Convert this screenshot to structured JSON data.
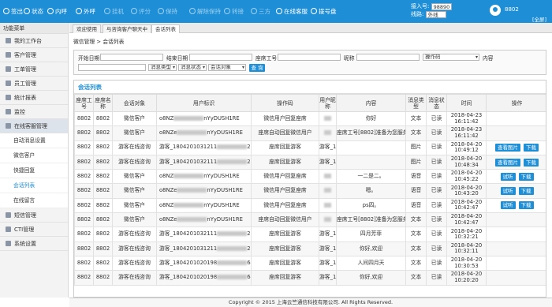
{
  "topbar": {
    "items": [
      {
        "label": "签出",
        "icon": "logout-icon",
        "active": true
      },
      {
        "label": "状态",
        "icon": "user-status-icon",
        "active": true
      },
      {
        "label": "内呼",
        "icon": "internal-call-icon",
        "active": true
      },
      {
        "label": "外呼",
        "icon": "outbound-call-icon",
        "active": true
      },
      {
        "label": "挂机",
        "icon": "hangup-icon",
        "active": false
      },
      {
        "label": "评分",
        "icon": "rating-icon",
        "active": false
      },
      {
        "label": "保持",
        "icon": "hold-icon",
        "active": false
      },
      {
        "label": "解除保持",
        "icon": "unhold-icon",
        "active": false
      },
      {
        "label": "转接",
        "icon": "transfer-icon",
        "active": false
      },
      {
        "label": "三方",
        "icon": "three-way-icon",
        "active": false
      },
      {
        "label": "在线客服",
        "icon": "online-service-icon",
        "active": true
      },
      {
        "label": "拨号盘",
        "icon": "dialpad-icon",
        "active": true
      }
    ],
    "extension_label": "接入号:",
    "extension_value": "98890",
    "line_label": "线路:",
    "line_value": "外线",
    "user": "8802",
    "fullscreen": "[全屏]"
  },
  "sidebar": {
    "title": "功能菜单",
    "items": [
      {
        "label": "我的工作台",
        "icon": "workbench-icon"
      },
      {
        "label": "客户管理",
        "icon": "customer-icon"
      },
      {
        "label": "工单管理",
        "icon": "ticket-icon"
      },
      {
        "label": "员工管理",
        "icon": "staff-icon"
      },
      {
        "label": "统计报表",
        "icon": "report-icon"
      },
      {
        "label": "监控",
        "icon": "monitor-icon"
      },
      {
        "label": "在线客服管理",
        "icon": "online-service-mgmt-icon"
      }
    ],
    "subitems": [
      "自动消息设置",
      "微信客户",
      "快捷回复",
      "会话列表",
      "在线留言"
    ],
    "items2": [
      {
        "label": "短信管理",
        "icon": "sms-icon"
      },
      {
        "label": "CTI管理",
        "icon": "cti-icon"
      },
      {
        "label": "系统设置",
        "icon": "settings-icon"
      }
    ]
  },
  "tabs": [
    "欢迎使用",
    "与咨询客户聊天中",
    "会话列表"
  ],
  "breadcrumb": "微信管理 > 会话列表",
  "filter": {
    "start_label": "开始日期",
    "end_label": "结束日期",
    "agent_label": "座席工号",
    "nick_label": "昵称",
    "action_code": "操作码",
    "content_label": "内容",
    "msg_type": "消息类型",
    "msg_status": "消息状态",
    "session_obj": "会话对象",
    "search": "查 询"
  },
  "list": {
    "title": "会话列表",
    "headers": [
      "座席工号",
      "座席名称",
      "会话对象",
      "用户标识",
      "操作码",
      "用户昵称",
      "内容",
      "消息类型",
      "消息状态",
      "时间",
      "操作"
    ],
    "rows": [
      [
        "8802",
        "8802",
        "微信客户",
        "o8NZ",
        "nYyDUSH1RE",
        "微信用户回复座席",
        "",
        "你好",
        "文本",
        "已读",
        "2018-04-23 16:11:42",
        []
      ],
      [
        "8802",
        "8802",
        "微信客户",
        "o8NZe",
        "nYyDUSH1RE",
        "座席自动回复微信用户",
        "",
        "座席工号[8802]准备为您服务",
        "文本",
        "已读",
        "2018-04-23 16:11:42",
        []
      ],
      [
        "8802",
        "8802",
        "游客在线咨询",
        "游客_1804201031211",
        "26",
        "座席回复游客",
        "游客_18",
        "",
        "图片",
        "已读",
        "2018-04-20 10:49:12",
        [
          "查看图片",
          "下载"
        ]
      ],
      [
        "8802",
        "8802",
        "游客在线咨询",
        "游客_1804201032111",
        "26",
        "座席回复游客",
        "游客_18",
        "",
        "图片",
        "已读",
        "2018-04-20 10:48:34",
        [
          "查看图片",
          "下载"
        ]
      ],
      [
        "8802",
        "8802",
        "微信客户",
        "o8NZ",
        "nYyDUSH1RE",
        "微信用户回复座席",
        "",
        "一二是二。",
        "语音",
        "已读",
        "2018-04-20 10:45:22",
        [
          "试听",
          "下载"
        ]
      ],
      [
        "8802",
        "8802",
        "微信客户",
        "o8NZe",
        "nYyDUSH1RE",
        "微信用户回复座席",
        "",
        "嗯。",
        "语音",
        "已读",
        "2018-04-20 10:43:20",
        [
          "试听",
          "下载"
        ]
      ],
      [
        "8802",
        "8802",
        "微信客户",
        "o8NZ",
        "nYyDUSH1RE",
        "微信用户回复座席",
        "",
        "ps四。",
        "语音",
        "已读",
        "2018-04-20 10:42:47",
        [
          "试听",
          "下载"
        ]
      ],
      [
        "8802",
        "8802",
        "微信客户",
        "o8NZe",
        "nYyDUSH1RE",
        "座席自动回复微信用户",
        "",
        "座席工号[8802]准备为您服务",
        "文本",
        "已读",
        "2018-04-20 10:42:47",
        []
      ],
      [
        "8802",
        "8802",
        "游客在线咨询",
        "游客_1804201032111",
        "26",
        "座席回复游客",
        "游客_18",
        "四月芳菲",
        "文本",
        "已读",
        "2018-04-20 10:32:21",
        []
      ],
      [
        "8802",
        "8802",
        "游客在线咨询",
        "游客_1804201031211",
        "26",
        "座席回复游客",
        "游客_18",
        "你好,欢迎",
        "文本",
        "已读",
        "2018-04-20 10:32:11",
        []
      ],
      [
        "8802",
        "8802",
        "游客在线咨询",
        "游客_1804201020198",
        "64",
        "座席回复游客",
        "游客_18",
        "人间四月天",
        "文本",
        "已读",
        "2018-04-20 10:30:53",
        []
      ],
      [
        "8802",
        "8802",
        "游客在线咨询",
        "游客_1804201020198",
        "64",
        "座席回复游客",
        "游客_18",
        "你好,欢迎",
        "文本",
        "已读",
        "2018-04-20 10:20:20",
        []
      ]
    ]
  },
  "footer": "Copyright © 2015 上海云竺通信科技有限公司. All Rights Reserved."
}
